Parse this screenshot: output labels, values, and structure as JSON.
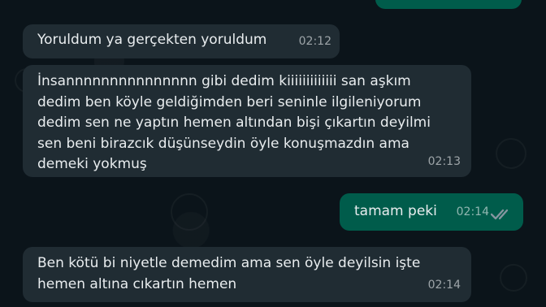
{
  "messages": [
    {
      "direction": "outgoing",
      "text": "",
      "time": ""
    },
    {
      "direction": "incoming",
      "text": "Yoruldum ya gerçekten yoruldum",
      "time": "02:12"
    },
    {
      "direction": "incoming",
      "text": "İnsannnnnnnnnnnnnnn gibi dedim kiiiiiiiiiiiii san aşkım\ndedim ben köyle geldiğimden beri seninle ilgileniyorum\ndedim sen ne yaptın hemen altından bişi çıkartın deyilmi\nsen beni birazcık düşünseydin öyle konuşmazdın ama\ndemeki yokmuş",
      "time": "02:13"
    },
    {
      "direction": "outgoing",
      "text": "tamam peki",
      "time": "02:14",
      "status": "read"
    },
    {
      "direction": "incoming",
      "text": "Ben kötü bi niyetle demedim ama sen öyle deyilsin işte\nhemen altına cıkartın hemen",
      "time": "02:14"
    }
  ],
  "colors": {
    "background": "#0b141a",
    "incoming_bubble": "#202c33",
    "outgoing_bubble": "#005c4b",
    "text": "#e9edef",
    "meta_text": "#8696a0",
    "read_ticks": "#8696a0"
  },
  "icons": {
    "read_status": "double-check-icon"
  }
}
